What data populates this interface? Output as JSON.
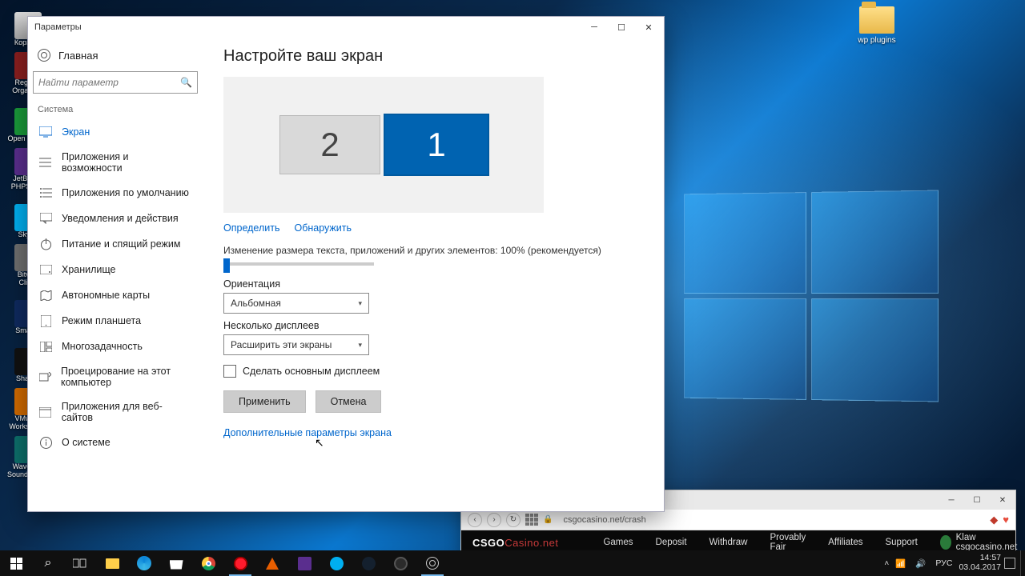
{
  "window": {
    "title": "Параметры",
    "home": "Главная",
    "searchPlaceholder": "Найти параметр",
    "section": "Система",
    "nav": {
      "display": "Экран",
      "apps": "Приложения и возможности",
      "defaultapps": "Приложения по умолчанию",
      "notifications": "Уведомления и действия",
      "power": "Питание и спящий режим",
      "storage": "Хранилище",
      "offlinemaps": "Автономные карты",
      "tablet": "Режим планшета",
      "multitask": "Многозадачность",
      "projecting": "Проецирование на этот компьютер",
      "webapps": "Приложения для веб-сайтов",
      "about": "О системе"
    }
  },
  "content": {
    "heading": "Настройте ваш экран",
    "mon1": "1",
    "mon2": "2",
    "identify": "Определить",
    "detect": "Обнаружить",
    "scaleDesc": "Изменение размера текста, приложений и других элементов: 100% (рекомендуется)",
    "orientationLabel": "Ориентация",
    "orientationValue": "Альбомная",
    "multiLabel": "Несколько дисплеев",
    "multiValue": "Расширить эти экраны",
    "makeMain": "Сделать основным дисплеем",
    "apply": "Применить",
    "cancel": "Отмена",
    "advanced": "Дополнительные параметры экрана"
  },
  "desktop": {
    "folder": "wp plugins",
    "icons": [
      "Корзина",
      "Registry\nOrganizer",
      "Open Server",
      "JetBrains\nPHPStorm",
      "Skype",
      "Bitvise\nClient",
      "Smart...",
      "ShareX",
      "VMware\nWorkstation",
      "WavePad\nSound Editor"
    ]
  },
  "browser": {
    "url": "csgocasino.net/crash",
    "logo1": "CSGO",
    "logo2": "Casino.net",
    "links": {
      "games": "Games",
      "deposit": "Deposit",
      "withdraw": "Withdraw",
      "provably": "Provably Fair",
      "affiliates": "Affiliates",
      "support": "Support"
    },
    "user": "Klaw csgocasino.net"
  },
  "tray": {
    "up": "˄",
    "lang": "РУС",
    "time": "14:57",
    "date": "03.04.2017"
  }
}
